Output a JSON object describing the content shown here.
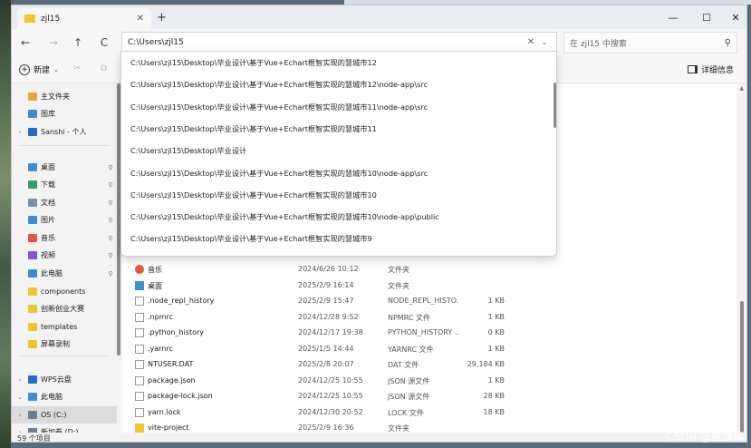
{
  "window": {
    "tab_title": "zjl15",
    "new_tab": "+",
    "minimize": "—",
    "maximize": "☐",
    "close": "✕"
  },
  "nav": {
    "back": "←",
    "forward": "→",
    "up": "↑",
    "refresh": "C",
    "address_value": "C:\\Users\\zjl15",
    "address_clear": "✕",
    "address_chevron": "⌄",
    "search_placeholder": "在 zjl15 中搜索",
    "search_icon": "⚲"
  },
  "commandbar": {
    "new_label": "新建",
    "new_chevron": "⌄",
    "details_label": "详细信息"
  },
  "sidebar": {
    "items": [
      {
        "label": "主文件夹",
        "icon": "home-icon",
        "color": "#e6a23c",
        "chev": "",
        "pin": ""
      },
      {
        "label": "图库",
        "icon": "gallery-icon",
        "color": "#3a8ed8",
        "chev": "",
        "pin": ""
      },
      {
        "label": "Sanshi - 个人",
        "icon": "onedrive-icon",
        "color": "#1e6fd0",
        "chev": "›",
        "pin": ""
      },
      {
        "label": "桌面",
        "icon": "desktop-icon",
        "color": "#3a8ed8",
        "chev": "",
        "pin": "⚲"
      },
      {
        "label": "下载",
        "icon": "download-icon",
        "color": "#2f9e6a",
        "chev": "",
        "pin": "⚲"
      },
      {
        "label": "文档",
        "icon": "documents-icon",
        "color": "#7a8fa6",
        "chev": "",
        "pin": "⚲"
      },
      {
        "label": "图片",
        "icon": "pictures-icon",
        "color": "#3a8ed8",
        "chev": "",
        "pin": "⚲"
      },
      {
        "label": "音乐",
        "icon": "music-icon",
        "color": "#e8553e",
        "chev": "",
        "pin": "⚲"
      },
      {
        "label": "视频",
        "icon": "videos-icon",
        "color": "#8a4fd8",
        "chev": "",
        "pin": "⚲"
      },
      {
        "label": "此电脑",
        "icon": "this-pc-icon",
        "color": "#3a8ed8",
        "chev": "",
        "pin": "⚲"
      },
      {
        "label": "components",
        "icon": "folder-icon",
        "color": "#f4c430",
        "chev": "",
        "pin": ""
      },
      {
        "label": "创新创业大赛",
        "icon": "folder-icon",
        "color": "#f4c430",
        "chev": "",
        "pin": ""
      },
      {
        "label": "templates",
        "icon": "folder-icon",
        "color": "#f4c430",
        "chev": "",
        "pin": ""
      },
      {
        "label": "屏幕录制",
        "icon": "folder-icon",
        "color": "#f4c430",
        "chev": "",
        "pin": ""
      },
      {
        "label": "WPS云盘",
        "icon": "wps-cloud-icon",
        "color": "#1e6fd0",
        "chev": "›",
        "pin": ""
      },
      {
        "label": "此电脑",
        "icon": "this-pc-icon",
        "color": "#3a8ed8",
        "chev": "⌄",
        "pin": ""
      },
      {
        "label": "OS (C:)",
        "icon": "drive-icon",
        "color": "#6f7c8a",
        "chev": "›",
        "pin": ""
      },
      {
        "label": "新加卷 (D:)",
        "icon": "drive-icon",
        "color": "#6f7c8a",
        "chev": "›",
        "pin": ""
      }
    ]
  },
  "dropdown": {
    "suggestions": [
      "C:\\Users\\zjl15\\Desktop\\毕业设计\\基于Vue+Echart框智实现的慧城市12",
      "C:\\Users\\zjl15\\Desktop\\毕业设计\\基于Vue+Echart框智实现的慧城市12\\node-app\\src",
      "C:\\Users\\zjl15\\Desktop\\毕业设计\\基于Vue+Echart框智实现的慧城市11\\node-app\\src",
      "C:\\Users\\zjl15\\Desktop\\毕业设计\\基于Vue+Echart框智实现的慧城市11",
      "C:\\Users\\zjl15\\Desktop\\毕业设计",
      "C:\\Users\\zjl15\\Desktop\\毕业设计\\基于Vue+Echart框智实现的慧城市10\\node-app\\src",
      "C:\\Users\\zjl15\\Desktop\\毕业设计\\基于Vue+Echart框智实现的慧城市10",
      "C:\\Users\\zjl15\\Desktop\\毕业设计\\基于Vue+Echart框智实现的慧城市10\\node-app\\public",
      "C:\\Users\\zjl15\\Desktop\\毕业设计\\基于Vue+Echart框智实现的慧城市9"
    ]
  },
  "files": [
    {
      "name": "音乐",
      "date": "2024/6/26 10:12",
      "type": "文件夹",
      "size": "",
      "icon": "music-icon"
    },
    {
      "name": "桌面",
      "date": "2025/2/9 16:14",
      "type": "文件夹",
      "size": "",
      "icon": "desktop-icon"
    },
    {
      "name": ".node_repl_history",
      "date": "2025/2/9 15:47",
      "type": "NODE_REPL_HISTO...",
      "size": "1 KB",
      "icon": "file-icon"
    },
    {
      "name": ".npmrc",
      "date": "2024/12/28 9:52",
      "type": "NPMRC 文件",
      "size": "1 KB",
      "icon": "file-icon"
    },
    {
      "name": ".python_history",
      "date": "2024/12/17 19:38",
      "type": "PYTHON_HISTORY ...",
      "size": "0 KB",
      "icon": "file-icon"
    },
    {
      "name": ".yarnrc",
      "date": "2025/1/5 14:44",
      "type": "YARNRC 文件",
      "size": "1 KB",
      "icon": "file-icon"
    },
    {
      "name": "NTUSER.DAT",
      "date": "2025/2/8 20:07",
      "type": "DAT 文件",
      "size": "29,184 KB",
      "icon": "file-icon"
    },
    {
      "name": "package.json",
      "date": "2024/12/25 10:55",
      "type": "JSON 源文件",
      "size": "1 KB",
      "icon": "json-icon"
    },
    {
      "name": "package-lock.json",
      "date": "2024/12/25 10:55",
      "type": "JSON 源文件",
      "size": "28 KB",
      "icon": "json-icon"
    },
    {
      "name": "yarn.lock",
      "date": "2024/12/30 20:52",
      "type": "LOCK 文件",
      "size": "18 KB",
      "icon": "file-icon"
    },
    {
      "name": "vite-project",
      "date": "2025/2/9 16:36",
      "type": "文件夹",
      "size": "",
      "icon": "folder-icon"
    }
  ],
  "status": {
    "item_count": "59 个项目"
  },
  "watermark": "CSDN @张謙霜"
}
